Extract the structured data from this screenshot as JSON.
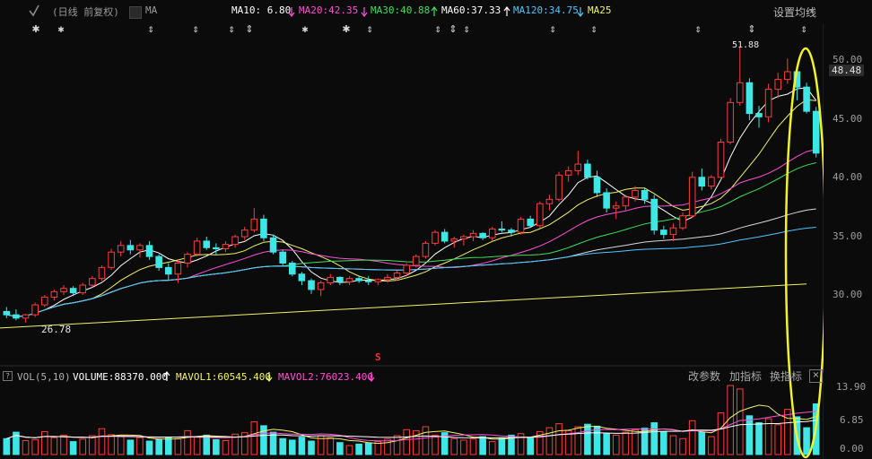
{
  "header": {
    "period_label": "(日线 前复权)",
    "ma_label": "MA",
    "ma10": "MA10: 6.80",
    "ma20": "MA20:42.35",
    "ma30": "MA30:40.88",
    "ma60": "MA60:37.33",
    "ma120": "MA120:34.75",
    "ma250": "MA25",
    "settings": "设置均线",
    "colors": {
      "ma10": "#ffffff",
      "ma20": "#ff4fd8",
      "ma30": "#3ee05a",
      "ma60": "#ffffff",
      "ma120": "#4fc6ff",
      "ma250": "#f2f26a"
    },
    "arrow_icons": [
      "arrow-down-icon",
      "arrow-down-icon",
      "arrow-up-icon",
      "arrow-up-icon",
      "arrow-up-icon",
      "arrow-down-icon"
    ]
  },
  "price_axis": {
    "ticks": [
      "50.00",
      "45.00",
      "40.00",
      "35.00",
      "30.00"
    ],
    "current_price": "48.48"
  },
  "annotations": {
    "low_label": "26.78",
    "high_label": "51.88",
    "marker": "S"
  },
  "volume_panel": {
    "title": "VOL(5,10)",
    "volume": "VOLUME:88370.000",
    "mavol1": "MAVOL1:60545.400",
    "mavol2": "MAVOL2:76023.400",
    "tools": [
      "改参数",
      "加指标",
      "换指标"
    ],
    "close": "×",
    "help": "?",
    "axis_ticks": [
      "13.90",
      "6.85",
      "0.00"
    ]
  },
  "chart_data": {
    "type": "candlestick",
    "ylim": [
      25,
      51.88
    ],
    "candles": [
      [
        27.8,
        28.2,
        27.2,
        27.5
      ],
      [
        27.5,
        28.0,
        27.0,
        27.2
      ],
      [
        27.2,
        27.6,
        26.8,
        27.5
      ],
      [
        27.5,
        28.6,
        27.3,
        28.4
      ],
      [
        28.4,
        29.3,
        28.2,
        29.1
      ],
      [
        29.1,
        29.8,
        28.8,
        29.6
      ],
      [
        29.6,
        30.2,
        29.3,
        29.9
      ],
      [
        29.9,
        30.1,
        29.2,
        29.5
      ],
      [
        29.5,
        30.4,
        29.3,
        30.2
      ],
      [
        30.2,
        31.0,
        30.0,
        30.8
      ],
      [
        30.8,
        32.0,
        30.6,
        31.8
      ],
      [
        31.8,
        33.5,
        31.6,
        33.2
      ],
      [
        33.2,
        34.2,
        32.8,
        33.8
      ],
      [
        33.8,
        34.3,
        33.0,
        33.4
      ],
      [
        33.4,
        34.0,
        32.7,
        33.8
      ],
      [
        33.8,
        34.2,
        32.5,
        32.8
      ],
      [
        32.8,
        33.0,
        31.5,
        31.8
      ],
      [
        31.8,
        32.2,
        30.6,
        31.2
      ],
      [
        31.2,
        32.5,
        30.4,
        32.2
      ],
      [
        32.2,
        33.2,
        31.8,
        33.0
      ],
      [
        33.0,
        34.5,
        32.8,
        34.2
      ],
      [
        34.2,
        34.6,
        33.4,
        33.6
      ],
      [
        33.6,
        34.0,
        33.0,
        33.5
      ],
      [
        33.5,
        34.2,
        33.2,
        33.9
      ],
      [
        33.9,
        34.8,
        33.6,
        34.6
      ],
      [
        34.6,
        35.5,
        34.3,
        35.2
      ],
      [
        35.2,
        37.2,
        35.0,
        36.2
      ],
      [
        36.2,
        36.6,
        34.2,
        34.5
      ],
      [
        34.5,
        34.8,
        33.0,
        33.2
      ],
      [
        33.2,
        33.4,
        32.0,
        32.2
      ],
      [
        32.2,
        32.4,
        31.0,
        31.2
      ],
      [
        31.2,
        31.4,
        30.2,
        30.6
      ],
      [
        30.6,
        30.8,
        29.4,
        29.8
      ],
      [
        29.8,
        30.6,
        29.2,
        30.4
      ],
      [
        30.4,
        31.2,
        30.2,
        30.9
      ],
      [
        30.9,
        31.0,
        30.2,
        30.5
      ],
      [
        30.5,
        31.0,
        30.2,
        30.8
      ],
      [
        30.8,
        31.0,
        30.4,
        30.6
      ],
      [
        30.6,
        31.0,
        30.2,
        30.5
      ],
      [
        30.5,
        30.8,
        30.2,
        30.7
      ],
      [
        30.7,
        31.2,
        30.4,
        30.9
      ],
      [
        30.9,
        31.5,
        30.6,
        31.3
      ],
      [
        31.3,
        32.2,
        31.0,
        32.0
      ],
      [
        32.0,
        33.0,
        31.8,
        32.8
      ],
      [
        32.8,
        34.2,
        32.6,
        34.0
      ],
      [
        34.0,
        35.2,
        33.8,
        35.0
      ],
      [
        35.0,
        35.3,
        34.0,
        34.2
      ],
      [
        34.2,
        34.6,
        33.6,
        34.4
      ],
      [
        34.4,
        34.8,
        33.8,
        34.6
      ],
      [
        34.6,
        35.2,
        34.2,
        34.9
      ],
      [
        34.9,
        35.0,
        34.3,
        34.5
      ],
      [
        34.5,
        35.5,
        34.2,
        35.3
      ],
      [
        35.3,
        36.0,
        35.0,
        35.2
      ],
      [
        35.2,
        35.4,
        34.6,
        35.0
      ],
      [
        35.0,
        36.4,
        34.8,
        36.2
      ],
      [
        36.2,
        36.5,
        35.4,
        35.6
      ],
      [
        35.6,
        37.8,
        35.4,
        37.6
      ],
      [
        37.6,
        38.4,
        37.0,
        38.0
      ],
      [
        38.0,
        40.5,
        37.8,
        40.2
      ],
      [
        40.2,
        41.0,
        39.6,
        40.6
      ],
      [
        40.6,
        42.4,
        40.2,
        41.2
      ],
      [
        41.2,
        41.6,
        39.8,
        40.0
      ],
      [
        40.0,
        40.6,
        38.2,
        38.6
      ],
      [
        38.6,
        39.0,
        36.8,
        37.2
      ],
      [
        37.2,
        37.8,
        36.2,
        37.4
      ],
      [
        37.4,
        38.4,
        37.0,
        38.2
      ],
      [
        38.2,
        39.2,
        37.8,
        38.8
      ],
      [
        38.8,
        39.0,
        37.6,
        38.0
      ],
      [
        38.0,
        38.4,
        34.8,
        35.2
      ],
      [
        35.2,
        35.6,
        34.4,
        34.8
      ],
      [
        34.8,
        35.8,
        34.2,
        35.4
      ],
      [
        35.4,
        36.8,
        35.2,
        36.5
      ],
      [
        36.5,
        40.5,
        36.3,
        40.0
      ],
      [
        40.0,
        40.8,
        38.8,
        39.2
      ],
      [
        39.2,
        40.2,
        38.9,
        40.0
      ],
      [
        40.0,
        43.5,
        39.8,
        43.2
      ],
      [
        43.2,
        47.2,
        43.0,
        46.8
      ],
      [
        46.8,
        51.9,
        46.5,
        48.6
      ],
      [
        48.6,
        49.0,
        45.2,
        45.8
      ],
      [
        45.8,
        46.5,
        44.5,
        45.5
      ],
      [
        45.5,
        48.5,
        45.0,
        48.0
      ],
      [
        48.0,
        49.5,
        47.2,
        48.9
      ],
      [
        48.9,
        50.8,
        48.5,
        49.6
      ],
      [
        49.6,
        49.8,
        47.0,
        48.2
      ],
      [
        48.2,
        48.6,
        45.8,
        46.0
      ],
      [
        46.0,
        46.4,
        41.8,
        42.2
      ]
    ],
    "volume": [
      3.2,
      4.5,
      2.8,
      3.0,
      4.6,
      3.4,
      3.9,
      2.6,
      3.1,
      3.8,
      5.2,
      4.0,
      3.6,
      2.9,
      3.4,
      2.7,
      3.0,
      3.5,
      3.2,
      4.8,
      3.6,
      3.9,
      3.0,
      2.8,
      4.1,
      4.4,
      6.6,
      5.8,
      4.5,
      3.2,
      2.9,
      3.5,
      2.7,
      3.8,
      3.4,
      2.4,
      1.8,
      2.1,
      2.3,
      2.6,
      3.1,
      3.8,
      5.0,
      4.8,
      5.6,
      3.9,
      4.4,
      3.2,
      2.9,
      3.1,
      3.6,
      2.6,
      3.3,
      3.9,
      4.2,
      3.5,
      4.6,
      5.4,
      6.2,
      4.8,
      5.6,
      6.1,
      5.7,
      4.2,
      3.9,
      4.5,
      5.0,
      5.3,
      6.4,
      4.6,
      3.8,
      3.2,
      6.8,
      4.5,
      3.6,
      8.4,
      13.9,
      13.2,
      7.8,
      6.4,
      7.2,
      6.0,
      9.1,
      7.6,
      5.4,
      10.2
    ]
  }
}
